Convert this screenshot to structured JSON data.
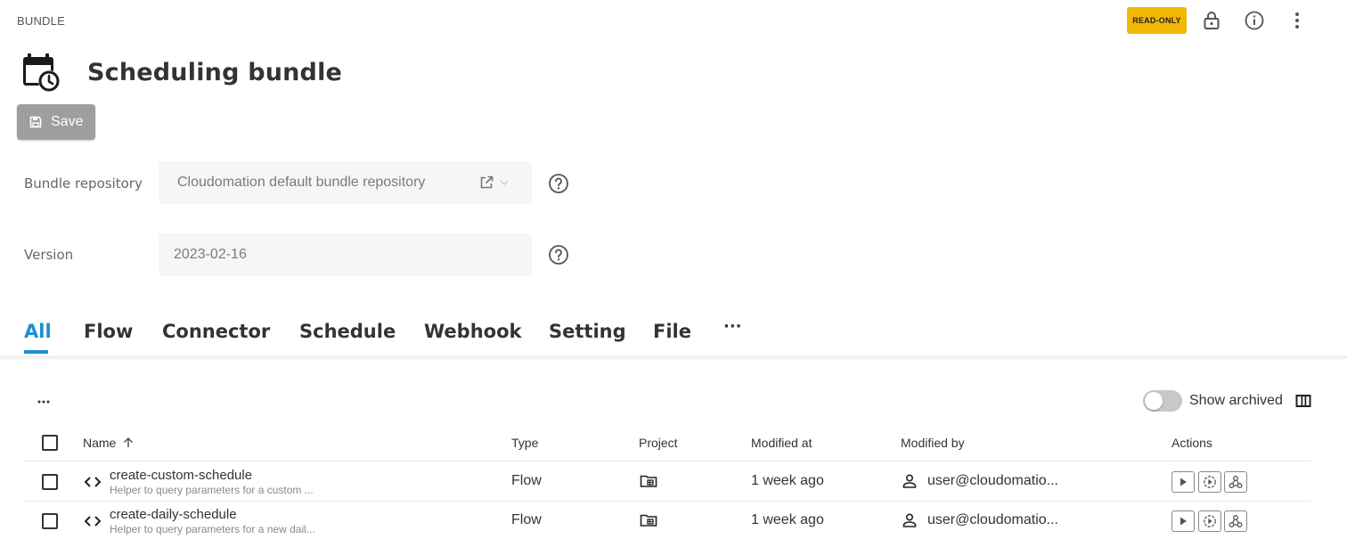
{
  "header": {
    "breadcrumb": "BUNDLE",
    "badge": "READ-ONLY",
    "badge_color": "#f2b705",
    "icons": [
      "lock-icon",
      "info-icon",
      "more-vertical-icon"
    ]
  },
  "page": {
    "title": "Scheduling bundle",
    "title_icon": "calendar-clock-icon"
  },
  "toolbar": {
    "save_label": "Save"
  },
  "form": {
    "repository_label": "Bundle repository",
    "repository_value": "Cloudomation default bundle repository",
    "version_label": "Version",
    "version_value": "2023-02-16"
  },
  "tabs": [
    {
      "label": "All",
      "active": true
    },
    {
      "label": "Flow"
    },
    {
      "label": "Connector"
    },
    {
      "label": "Schedule"
    },
    {
      "label": "Webhook"
    },
    {
      "label": "Setting"
    },
    {
      "label": "File"
    },
    {
      "label": "···"
    }
  ],
  "accent_color": "#1b8fd0",
  "table": {
    "show_archived_label": "Show archived",
    "columns": {
      "name": "Name",
      "type": "Type",
      "project": "Project",
      "modified_at": "Modified at",
      "modified_by": "Modified by",
      "actions": "Actions"
    },
    "rows": [
      {
        "name": "create-custom-schedule",
        "description": "Helper to query parameters for a custom ...",
        "type": "Flow",
        "modified_at": "1 week ago",
        "modified_by": "user@cloudomatio..."
      },
      {
        "name": "create-daily-schedule",
        "description": "Helper to query parameters for a new dail...",
        "type": "Flow",
        "modified_at": "1 week ago",
        "modified_by": "user@cloudomatio..."
      }
    ]
  }
}
